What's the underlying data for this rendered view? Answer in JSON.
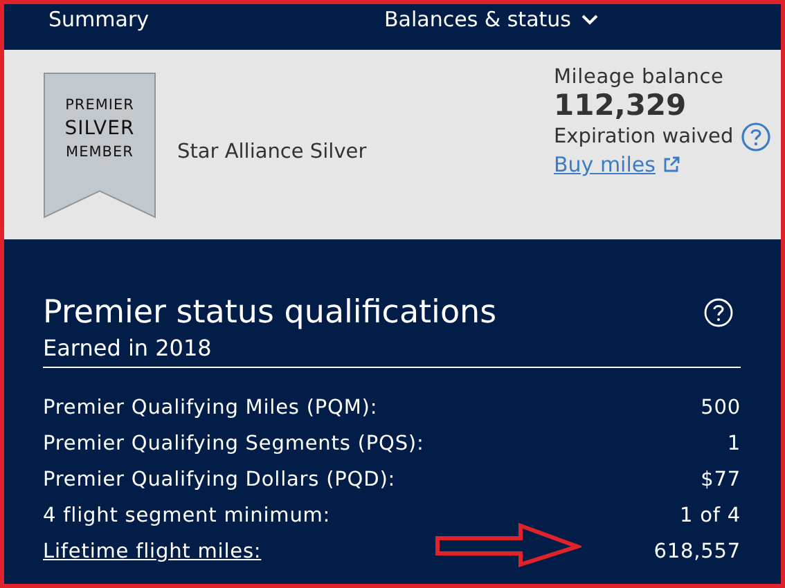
{
  "nav": {
    "items": [
      {
        "label": "Summary",
        "kind": "link"
      },
      {
        "label": "Balances & status",
        "kind": "dropdown"
      }
    ]
  },
  "member": {
    "badge": [
      "PREMIER",
      "SILVER",
      "MEMBER"
    ],
    "alliance": "Star Alliance Silver"
  },
  "mileage": {
    "label": "Mileage balance",
    "value": "112,329",
    "note": "Expiration waived",
    "link": "Buy miles"
  },
  "qualifications": {
    "title": "Premier status qualifications",
    "subtitle": "Earned in 2018",
    "rows": [
      {
        "label": "Premier Qualifying Miles (PQM):",
        "value": "500",
        "kind": "text"
      },
      {
        "label": "Premier Qualifying Segments (PQS):",
        "value": "1",
        "kind": "text"
      },
      {
        "label": "Premier Qualifying Dollars (PQD):",
        "value": "$77",
        "kind": "text"
      },
      {
        "label": "4 flight segment minimum:",
        "value": "1 of 4",
        "kind": "text"
      },
      {
        "label": "Lifetime flight miles:",
        "value": "618,557",
        "kind": "link"
      }
    ]
  }
}
